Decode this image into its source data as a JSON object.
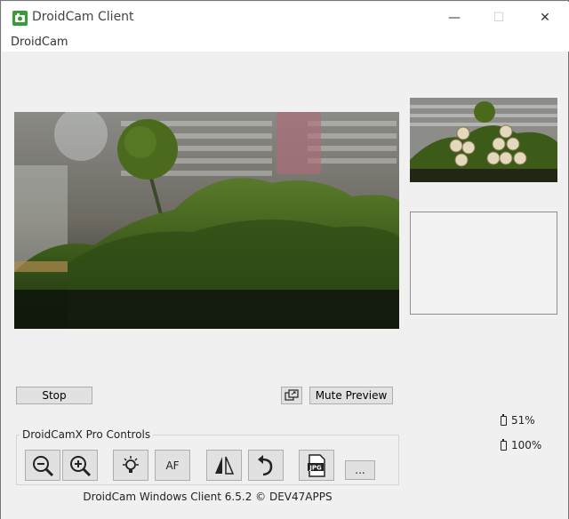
{
  "window": {
    "title": "DroidCam Client",
    "minimize_glyph": "—",
    "maximize_glyph": "☐",
    "close_glyph": "✕"
  },
  "menu": {
    "items": [
      "DroidCam"
    ]
  },
  "preview": {
    "main_icon": "camera-feed",
    "thumb_icon": "camera-thumbnail"
  },
  "controls": {
    "stop_label": "Stop",
    "mute_preview_label": "Mute Preview",
    "popout_icon": "popout-icon"
  },
  "status": {
    "battery_1": "51%",
    "battery_2": "100%"
  },
  "pro_controls": {
    "legend": "DroidCamX Pro Controls",
    "af_label": "AF",
    "more_label": "...",
    "tools": [
      "zoom-out-icon",
      "zoom-in-icon",
      "light-icon",
      "af",
      "mirror-icon",
      "rotate-icon",
      "jpg-icon",
      "more"
    ]
  },
  "footer": {
    "text": "DroidCam Windows Client 6.5.2 © DEV47APPS"
  },
  "colors": {
    "app_icon_green": "#3b9a3e",
    "button_face": "#e1e1e1",
    "button_border": "#adadad",
    "window_bg": "#f0f0f0"
  }
}
